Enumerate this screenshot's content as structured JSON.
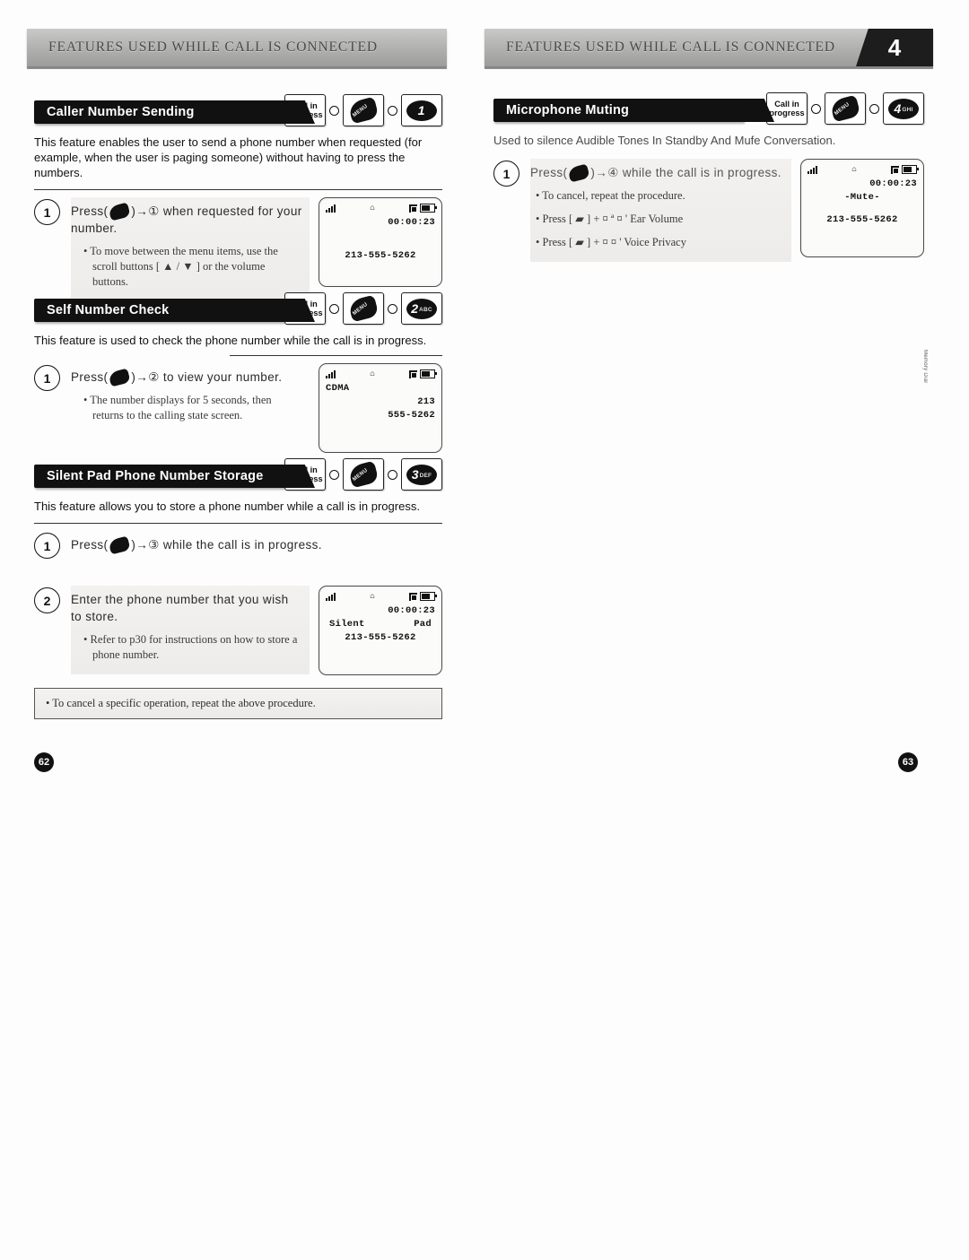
{
  "document": {
    "chapter_number": "4",
    "running_header": "FEATURES USED WHILE CALL IS CONNECTED",
    "side_mark": "Memory Dial"
  },
  "pages": {
    "left": {
      "page_number": "62",
      "header": "FEATURES USED WHILE CALL IS CONNECTED",
      "footer_note": "• To cancel a specific operation, repeat the above procedure."
    },
    "right": {
      "page_number": "63",
      "header": "FEATURES USED WHILE CALL IS CONNECTED",
      "chapter_tab": "4"
    }
  },
  "keys": {
    "call_in_progress_line1": "Call in",
    "call_in_progress_line2": "progress",
    "menu_label": "MENU",
    "connector": "o"
  },
  "sections": [
    {
      "id": "caller-number-sending",
      "title": "Caller Number Sending",
      "key_sequence": {
        "digit": "1",
        "letters": ""
      },
      "description": "This feature enables the user to send a phone number when requested (for example, when the user is paging someone) without having to press the numbers.",
      "steps": [
        {
          "number": "1",
          "text_before": "Press(",
          "text_after": ")→① when requested for your number.",
          "circled_target": "1",
          "bullets": [
            "• To move between the menu items, use the scroll buttons [ ▲ / ▼ ] or the volume buttons."
          ],
          "lcd": {
            "time": "00:00:23",
            "mid": "",
            "number": "213-555-5262"
          }
        }
      ]
    },
    {
      "id": "self-number-check",
      "title": "Self Number Check",
      "key_sequence": {
        "digit": "2",
        "letters": "ABC"
      },
      "description": "This feature is used to check the phone number while the call is in progress.",
      "steps": [
        {
          "number": "1",
          "text_before": "Press(",
          "text_after": ")→② to view your number.",
          "circled_target": "2",
          "bullets": [
            "• The number displays for 5 seconds, then returns to the calling state screen."
          ],
          "lcd": {
            "mode": "CDMA",
            "area": "213",
            "number": "555-5262"
          }
        }
      ]
    },
    {
      "id": "silent-pad-phone-number-storage",
      "title": "Silent Pad Phone Number Storage",
      "key_sequence": {
        "digit": "3",
        "letters": "DEF"
      },
      "description": "This feature allows you to store a phone number while a call is in progress.",
      "steps": [
        {
          "number": "1",
          "text_before": "Press(",
          "text_after": ")→③ while the call is in progress.",
          "circled_target": "3",
          "bullets": [],
          "lcd": null
        },
        {
          "number": "2",
          "text_before": "",
          "text_after": "Enter the phone number that you wish to store.",
          "circled_target": "",
          "bullets": [
            "• Refer to p30 for instructions on how to store a phone number."
          ],
          "lcd": {
            "time": "00:00:23",
            "label_left": "Silent",
            "label_right": "Pad",
            "number": "213-555-5262"
          }
        }
      ]
    },
    {
      "id": "microphone-muting",
      "title": "Microphone Muting",
      "key_sequence": {
        "digit": "4",
        "letters": "GHI"
      },
      "description": "Used to silence Audible Tones In Standby And Mufe Conversation.",
      "steps": [
        {
          "number": "1",
          "text_before": "Press(",
          "text_after": ")→④ while the call is in progress.",
          "circled_target": "4",
          "bullets": [
            "• To cancel, repeat the procedure.",
            "• Press [ ▰ ] + ¤ ª ¤ ' Ear Volume",
            "• Press [ ▰ ] + ¤   ¤ ' Voice Privacy"
          ],
          "lcd": {
            "time": "00:00:23",
            "mid": "-Mute-",
            "number": "213-555-5262"
          }
        }
      ]
    }
  ]
}
